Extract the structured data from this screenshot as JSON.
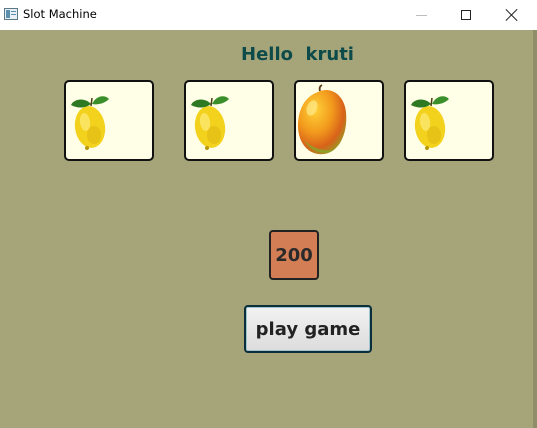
{
  "window": {
    "title": "Slot Machine",
    "background": "#a6a57a",
    "controls": [
      "minimize",
      "maximize",
      "close"
    ]
  },
  "greeting": "Hello  kruti",
  "reels": [
    {
      "symbol": "lemon-icon"
    },
    {
      "symbol": "lemon-icon"
    },
    {
      "symbol": "mango-icon"
    },
    {
      "symbol": "lemon-icon"
    }
  ],
  "credit": "200",
  "play_button": {
    "label": "play game"
  },
  "colors": {
    "greeting": "#0d4a4a",
    "credit_bg": "#d47e55",
    "reel_bg": "#fffee6"
  }
}
